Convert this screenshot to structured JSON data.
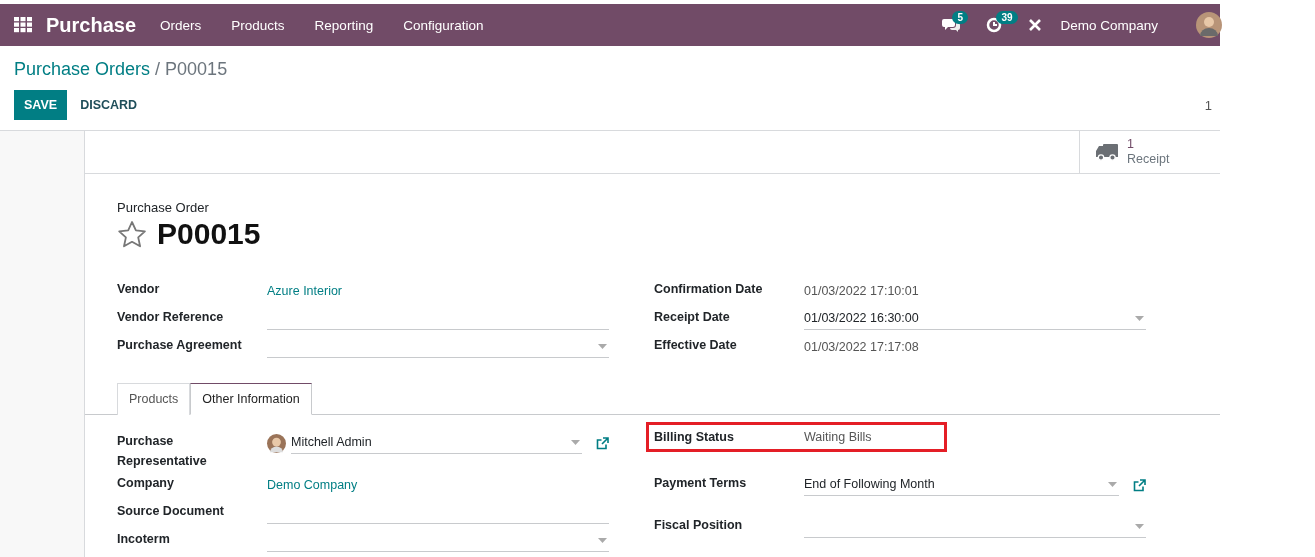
{
  "navbar": {
    "app": "Purchase",
    "menu": [
      "Orders",
      "Products",
      "Reporting",
      "Configuration"
    ],
    "messages_badge": "5",
    "activities_badge": "39",
    "company": "Demo Company"
  },
  "breadcrumb": {
    "parent": "Purchase Orders",
    "separator": "/",
    "current": "P00015"
  },
  "buttons": {
    "save": "SAVE",
    "discard": "DISCARD"
  },
  "pager": "1",
  "smart_button": {
    "count": "1",
    "label": "Receipt"
  },
  "sheet": {
    "subtitle": "Purchase Order",
    "title": "P00015",
    "starred": false
  },
  "groups": [
    [
      {
        "label": "Vendor",
        "value": "Azure Interior",
        "kind": "link"
      },
      {
        "label": "Vendor Reference",
        "kind": "input"
      },
      {
        "label": "Purchase Agreement",
        "kind": "select"
      }
    ],
    [
      {
        "label": "Confirmation Date",
        "value": "01/03/2022 17:10:01",
        "kind": "readonly"
      },
      {
        "label": "Receipt Date",
        "value": "01/03/2022 16:30:00",
        "kind": "select"
      },
      {
        "label": "Effective Date",
        "value": "01/03/2022 17:17:08",
        "kind": "readonly"
      }
    ]
  ],
  "tabs": [
    {
      "label": "Products",
      "selected": false
    },
    {
      "label": "Other Information",
      "selected": true
    }
  ],
  "tab_groups": [
    [
      {
        "label": "Purchase Representative",
        "value": "Mitchell Admin",
        "kind": "user",
        "external_link": true
      },
      {
        "label": "Company",
        "value": "Demo Company",
        "kind": "link"
      },
      {
        "label": "Source Document",
        "kind": "input"
      },
      {
        "label": "Incoterm",
        "kind": "select"
      }
    ],
    [
      {
        "label": "Billing Status",
        "value": "Waiting Bills",
        "kind": "readonly",
        "highlighted": true
      },
      {
        "label": "Payment Terms",
        "value": "End of Following Month",
        "kind": "select",
        "external_link": true
      },
      {
        "label": "Fiscal Position",
        "kind": "select"
      }
    ]
  ]
}
